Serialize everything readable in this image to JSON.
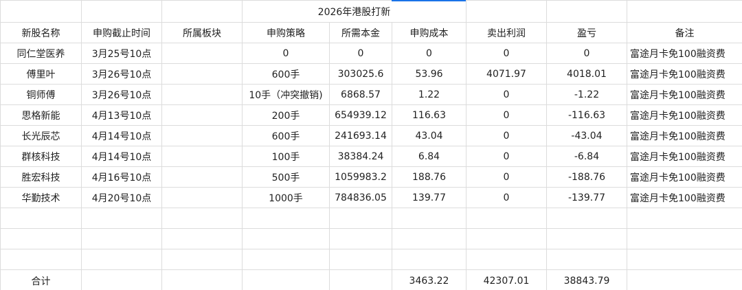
{
  "sheet": {
    "title": "2026年港股打新",
    "headers": [
      "新股名称",
      "申购截止时间",
      "所属板块",
      "申购策略",
      "所需本金",
      "申购成本",
      "卖出利润",
      "盈亏",
      "备注"
    ],
    "rows": [
      {
        "name": "同仁堂医养",
        "deadline": "3月25号10点",
        "sector": "",
        "strategy": "0",
        "capital": "0",
        "cost": "0",
        "profit": "0",
        "pnl": "0",
        "note": "富途月卡免100融资费"
      },
      {
        "name": "傅里叶",
        "deadline": "3月26号10点",
        "sector": "",
        "strategy": "600手",
        "capital": "303025.6",
        "cost": "53.96",
        "profit": "4071.97",
        "pnl": "4018.01",
        "note": "富途月卡免100融资费"
      },
      {
        "name": "铜师傅",
        "deadline": "3月26号10点",
        "sector": "",
        "strategy": "10手（冲突撤销)",
        "capital": "6868.57",
        "cost": "1.22",
        "profit": "0",
        "pnl": "-1.22",
        "note": "富途月卡免100融资费"
      },
      {
        "name": "思格新能",
        "deadline": "4月13号10点",
        "sector": "",
        "strategy": "200手",
        "capital": "654939.12",
        "cost": "116.63",
        "profit": "0",
        "pnl": "-116.63",
        "note": "富途月卡免100融资费"
      },
      {
        "name": "长光辰芯",
        "deadline": "4月14号10点",
        "sector": "",
        "strategy": "600手",
        "capital": "241693.14",
        "cost": "43.04",
        "profit": "0",
        "pnl": "-43.04",
        "note": "富途月卡免100融资费"
      },
      {
        "name": "群核科技",
        "deadline": "4月14号10点",
        "sector": "",
        "strategy": "100手",
        "capital": "38384.24",
        "cost": "6.84",
        "profit": "0",
        "pnl": "-6.84",
        "note": "富途月卡免100融资费"
      },
      {
        "name": "胜宏科技",
        "deadline": "4月16号10点",
        "sector": "",
        "strategy": "500手",
        "capital": "1059983.2",
        "cost": "188.76",
        "profit": "0",
        "pnl": "-188.76",
        "note": "富途月卡免100融资费"
      },
      {
        "name": "华勤技术",
        "deadline": "4月20号10点",
        "sector": "",
        "strategy": "1000手",
        "capital": "784836.05",
        "cost": "139.77",
        "profit": "0",
        "pnl": "-139.77",
        "note": "富途月卡免100融资费"
      }
    ],
    "total": {
      "label": "合计",
      "cost": "3463.22",
      "profit": "42307.01",
      "pnl": "38843.79"
    },
    "selection_color": "#1a73e8"
  }
}
